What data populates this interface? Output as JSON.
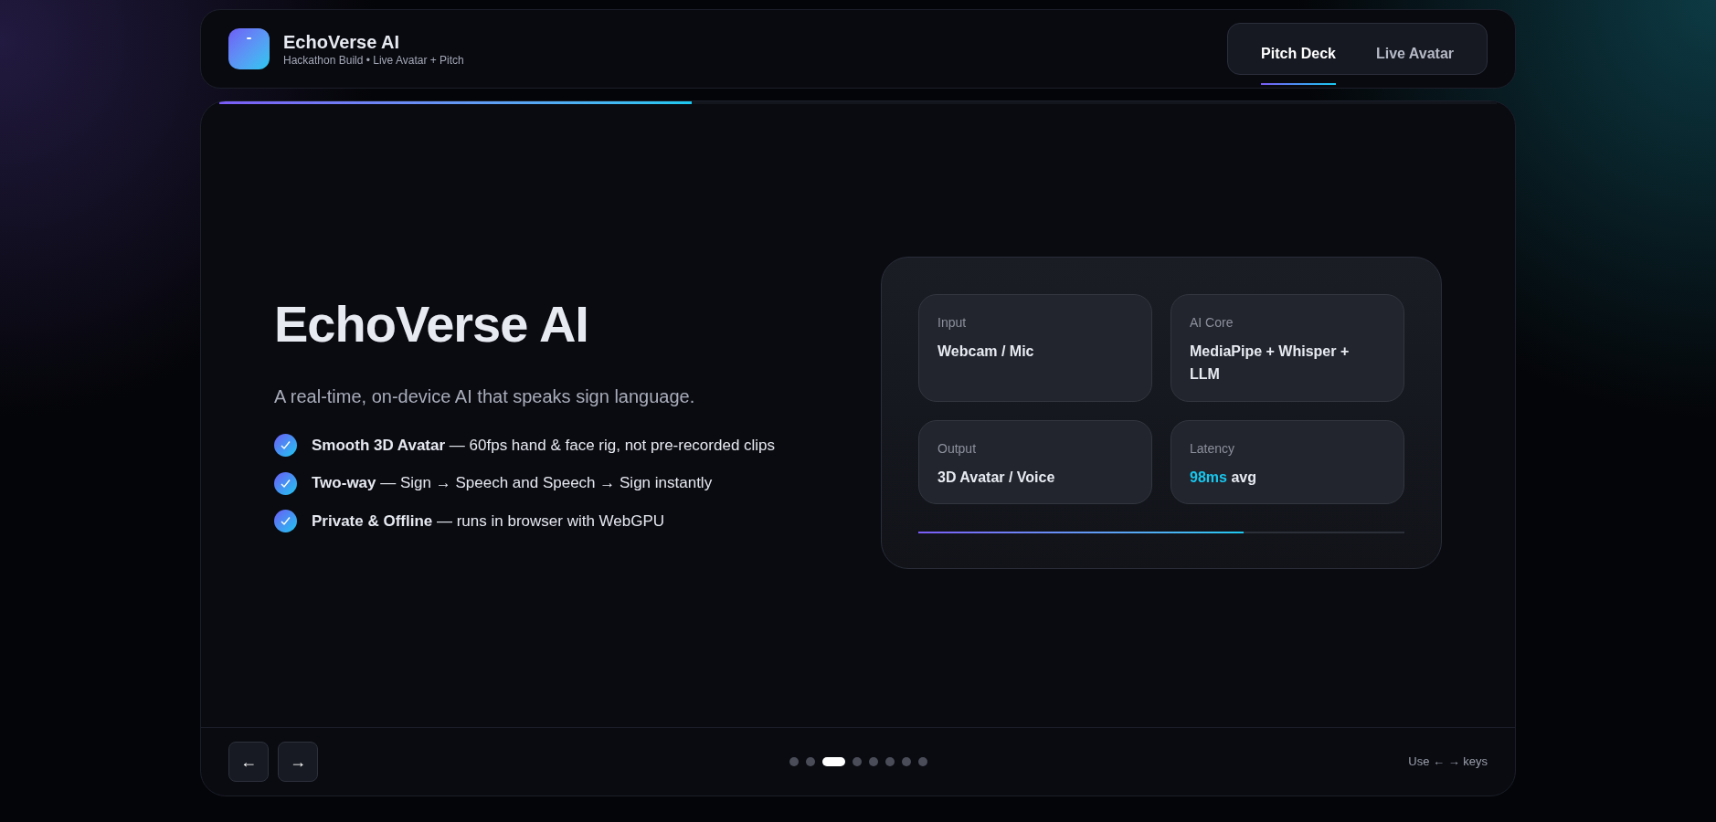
{
  "header": {
    "title": "EchoVerse AI",
    "subtitle": "Hackathon Build • Live Avatar + Pitch"
  },
  "tabs": [
    {
      "label": "Pitch Deck",
      "selected": true
    },
    {
      "label": "Live Avatar",
      "selected": false
    }
  ],
  "slide_progress": {
    "level": 0.37
  },
  "slide": {
    "title": "EchoVerse AI",
    "subtitle": "A real-time, on-device AI that speaks sign language.",
    "features": [
      "**Smooth 3D Avatar** — 60fps hand & face rig, not pre-recorded clips",
      "**Two-way** — Sign → Speech and Speech → Sign instantly",
      "**Private & Offline** — runs in browser with WebGPU"
    ]
  },
  "stats_card": {
    "tiles": [
      {
        "label": "Input",
        "value": "Webcam / Mic"
      },
      {
        "label": "AI Core",
        "value": "MediaPipe + Whisper + LLM"
      },
      {
        "label": "Output",
        "value": "3D Avatar / Voice"
      },
      {
        "label": "Latency",
        "highlight": "98ms",
        "value": "avg"
      }
    ],
    "progress": {
      "level": 0.67
    }
  },
  "footer": {
    "prev": "←",
    "next": "→",
    "dots": [
      {
        "selected": false
      },
      {
        "selected": false
      },
      {
        "selected": true
      },
      {
        "selected": false
      },
      {
        "selected": false
      },
      {
        "selected": false
      },
      {
        "selected": false
      },
      {
        "selected": false
      }
    ],
    "hint": "Use ← → keys"
  }
}
